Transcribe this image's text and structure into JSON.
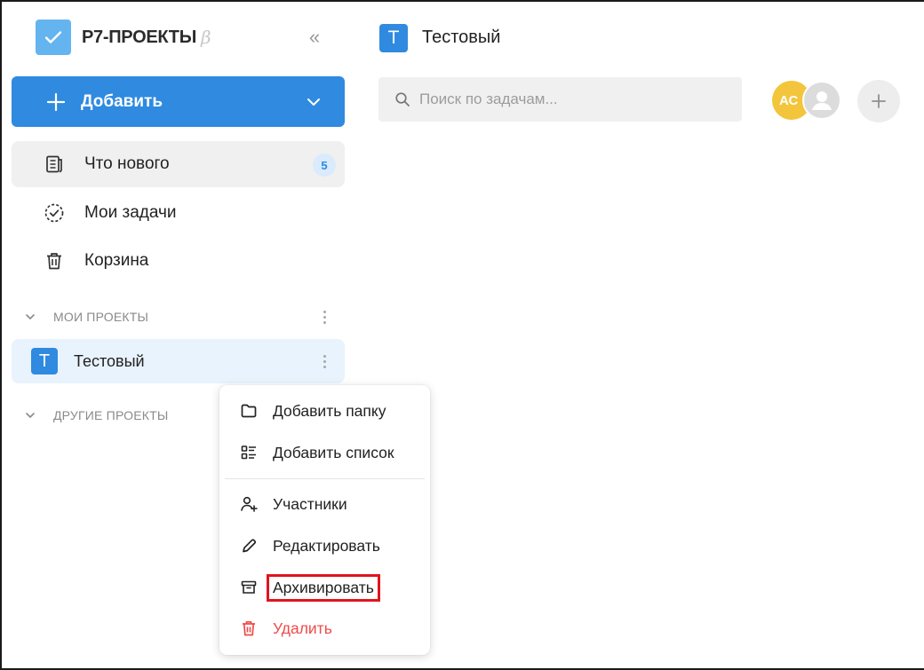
{
  "app": {
    "logo_text": "Р7-ПРОЕКТЫ",
    "beta_mark": "β",
    "collapse_glyph": "«"
  },
  "add_button": {
    "label": "Добавить"
  },
  "nav": [
    {
      "label": "Что нового",
      "badge": "5",
      "icon": "news-icon"
    },
    {
      "label": "Мои задачи",
      "icon": "task-check-icon"
    },
    {
      "label": "Корзина",
      "icon": "trash-icon"
    }
  ],
  "sections": {
    "my_projects": "МОИ ПРОЕКТЫ",
    "other_projects": "ДРУГИЕ ПРОЕКТЫ"
  },
  "project": {
    "initial": "Т",
    "name": "Тестовый"
  },
  "header": {
    "initial": "Т",
    "title": "Тестовый"
  },
  "search": {
    "placeholder": "Поиск по задачам..."
  },
  "users": {
    "first_initials": "АС"
  },
  "context_menu": {
    "items": [
      {
        "label": "Добавить папку",
        "icon": "folder-icon"
      },
      {
        "label": "Добавить список",
        "icon": "list-icon"
      },
      {
        "label": "Участники",
        "icon": "add-member-icon"
      },
      {
        "label": "Редактировать",
        "icon": "pencil-icon"
      },
      {
        "label": "Архивировать",
        "icon": "archive-icon"
      },
      {
        "label": "Удалить",
        "icon": "delete-icon"
      }
    ]
  },
  "colors": {
    "accent": "#2f8ae0",
    "danger": "#ee4b4b",
    "highlight": "#e0141e"
  }
}
